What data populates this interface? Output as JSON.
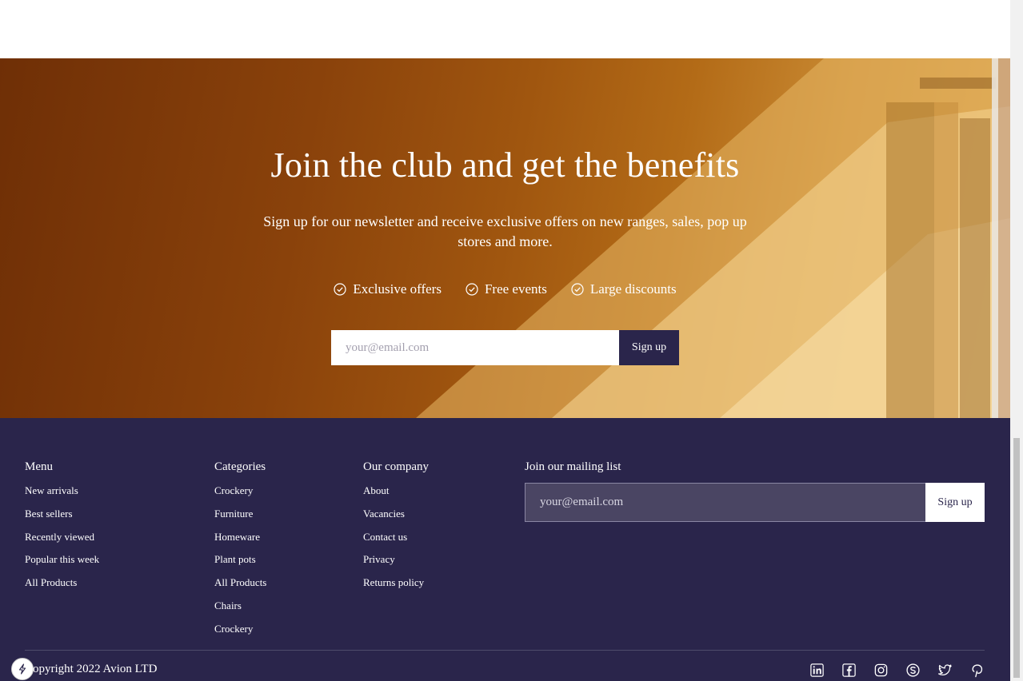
{
  "hero": {
    "title": "Join the club and get the benefits",
    "subtitle": "Sign up for our newsletter and receive exclusive offers on new ranges, sales, pop up stores and more.",
    "benefits": [
      "Exclusive offers",
      "Free events",
      "Large discounts"
    ],
    "email_placeholder": "your@email.com",
    "signup_label": "Sign up"
  },
  "footer": {
    "menu": {
      "title": "Menu",
      "links": [
        "New arrivals",
        "Best sellers",
        "Recently viewed",
        "Popular this week",
        "All Products"
      ]
    },
    "categories": {
      "title": "Categories",
      "links": [
        "Crockery",
        "Furniture",
        "Homeware",
        "Plant pots",
        "All Products",
        "Chairs",
        "Crockery"
      ]
    },
    "company": {
      "title": "Our company",
      "links": [
        "About",
        "Vacancies",
        "Contact us",
        "Privacy",
        "Returns policy"
      ]
    },
    "mailing": {
      "title": "Join our mailing list",
      "email_placeholder": "your@email.com",
      "signup_label": "Sign up"
    },
    "copyright": "Copyright 2022 Avion LTD",
    "socials": [
      "linkedin-icon",
      "facebook-icon",
      "instagram-icon",
      "skype-icon",
      "twitter-icon",
      "pinterest-icon"
    ]
  },
  "colors": {
    "primary": "#2a254b",
    "white": "#ffffff",
    "hero_warm": "#a0560f"
  }
}
